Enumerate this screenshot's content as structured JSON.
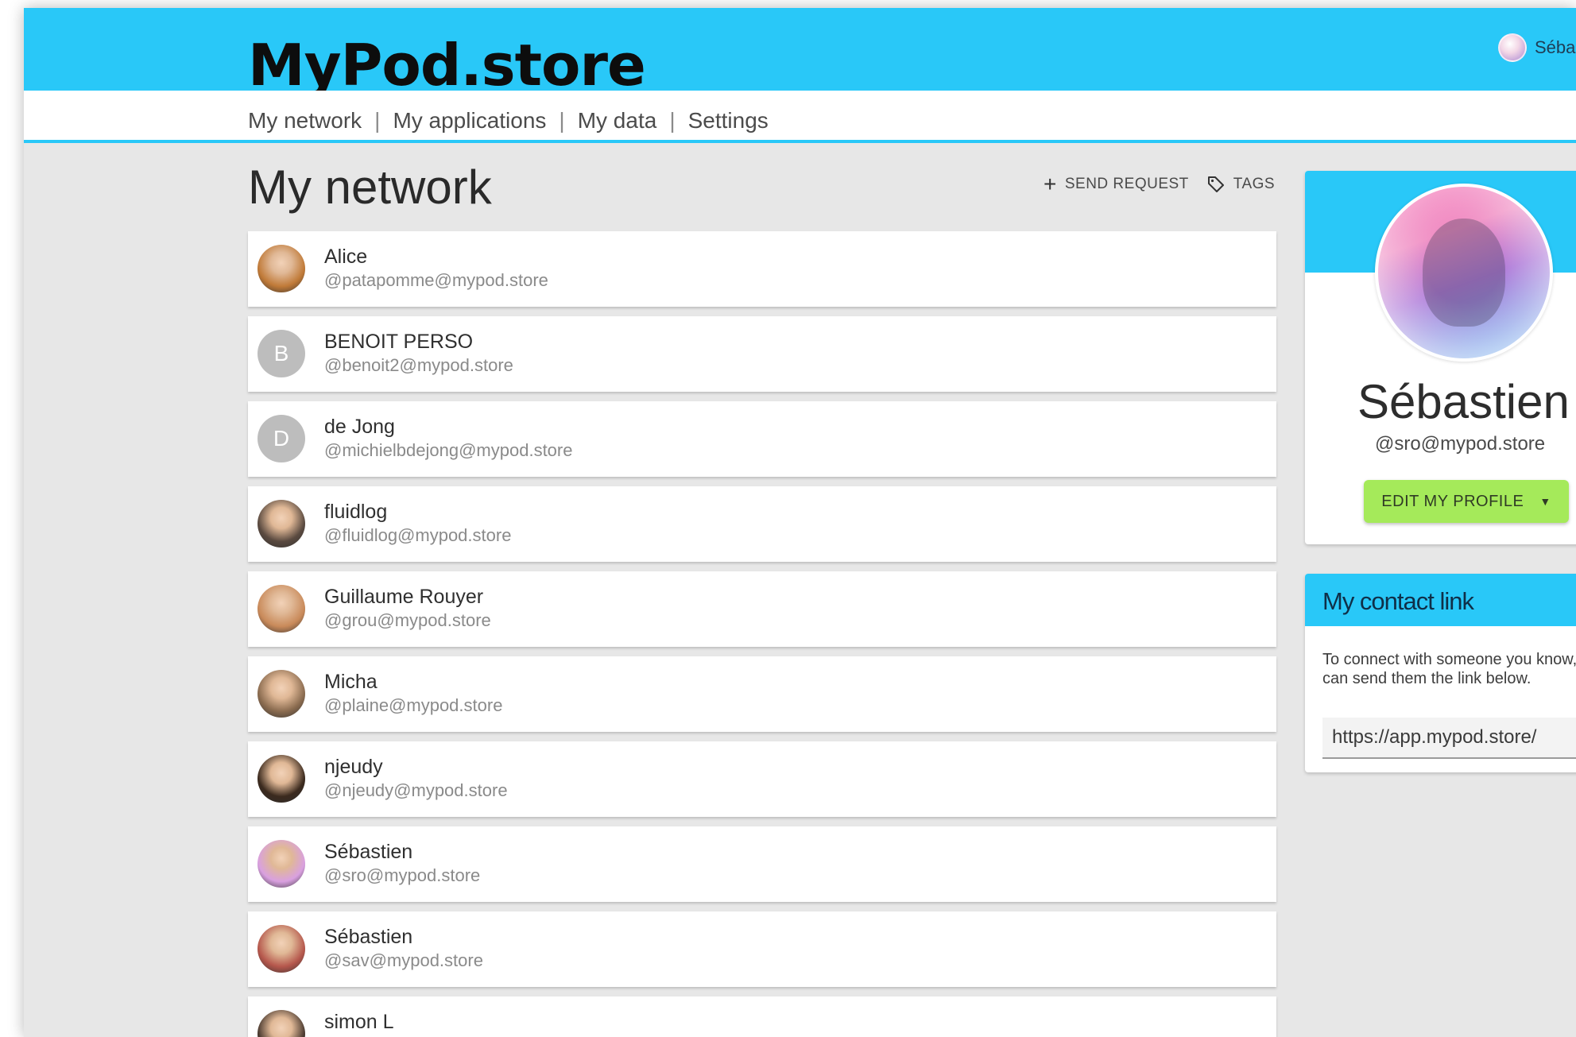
{
  "header": {
    "brand": "MyPod.store",
    "user_label": "Séba"
  },
  "nav": {
    "items": [
      "My network",
      "My applications",
      "My data",
      "Settings"
    ],
    "separator": "|"
  },
  "main": {
    "title": "My network",
    "actions": {
      "send_request": "SEND REQUEST",
      "tags": "TAGS"
    }
  },
  "contacts": [
    {
      "name": "Alice",
      "handle": "@patapomme@mypod.store",
      "avatar": "photo",
      "avatar_color": "#c07a38"
    },
    {
      "name": "BENOIT PERSO",
      "handle": "@benoit2@mypod.store",
      "avatar": "initial",
      "initial": "B",
      "avatar_color": "#bdbdbd"
    },
    {
      "name": "de Jong",
      "handle": "@michielbdejong@mypod.store",
      "avatar": "initial",
      "initial": "D",
      "avatar_color": "#bdbdbd"
    },
    {
      "name": "fluidlog",
      "handle": "@fluidlog@mypod.store",
      "avatar": "photo",
      "avatar_color": "#5a4a40"
    },
    {
      "name": "Guillaume Rouyer",
      "handle": "@grou@mypod.store",
      "avatar": "photo",
      "avatar_color": "#c98a5a"
    },
    {
      "name": "Micha",
      "handle": "@plaine@mypod.store",
      "avatar": "photo",
      "avatar_color": "#8a6b4f"
    },
    {
      "name": "njeudy",
      "handle": "@njeudy@mypod.store",
      "avatar": "photo",
      "avatar_color": "#3b2a1e"
    },
    {
      "name": "Sébastien",
      "handle": "@sro@mypod.store",
      "avatar": "photo",
      "avatar_color": "#d9a0e0"
    },
    {
      "name": "Sébastien",
      "handle": "@sav@mypod.store",
      "avatar": "photo",
      "avatar_color": "#b5574c"
    },
    {
      "name": "simon L",
      "handle": "",
      "avatar": "photo",
      "avatar_color": "#4a3a30"
    }
  ],
  "profile": {
    "name": "Sébastien",
    "handle": "@sro@mypod.store",
    "edit_label": "EDIT MY PROFILE"
  },
  "contact_link": {
    "title": "My contact link",
    "description": "To connect with someone you know, you can send them the link below.",
    "url": "https://app.mypod.store/"
  },
  "colors": {
    "brand_blue": "#29c8f8",
    "button_green": "#a5ea5a",
    "page_bg": "#e7e7e7"
  }
}
